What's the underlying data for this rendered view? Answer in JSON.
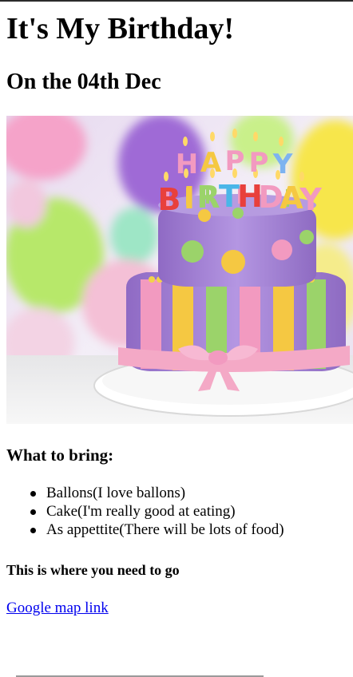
{
  "page": {
    "title": "It's My Birthday!",
    "date_heading": "On the 04th Dec",
    "hero_image": {
      "alt": "birthday cake",
      "letters_top": [
        "H",
        "A",
        "P",
        "P",
        "Y"
      ],
      "letters_bottom": [
        "B",
        "I",
        "R",
        "T",
        "H",
        "D",
        "A",
        "Y"
      ],
      "colors": {
        "cake_purple": "#a685d6",
        "ribbon_pink": "#f4a9c6",
        "stripe_yellow": "#f5c842",
        "stripe_green": "#9bd36a",
        "stripe_pink": "#f29ac0"
      }
    },
    "bring_heading": "What to bring:",
    "bring_items": [
      "Ballons(I love ballons)",
      "Cake(I'm really good at eating)",
      "As appettite(There will be lots of food)"
    ],
    "location_heading": "This is where you need to go",
    "map_link": {
      "label": "Google map link",
      "link_color": "#0000ee"
    }
  }
}
